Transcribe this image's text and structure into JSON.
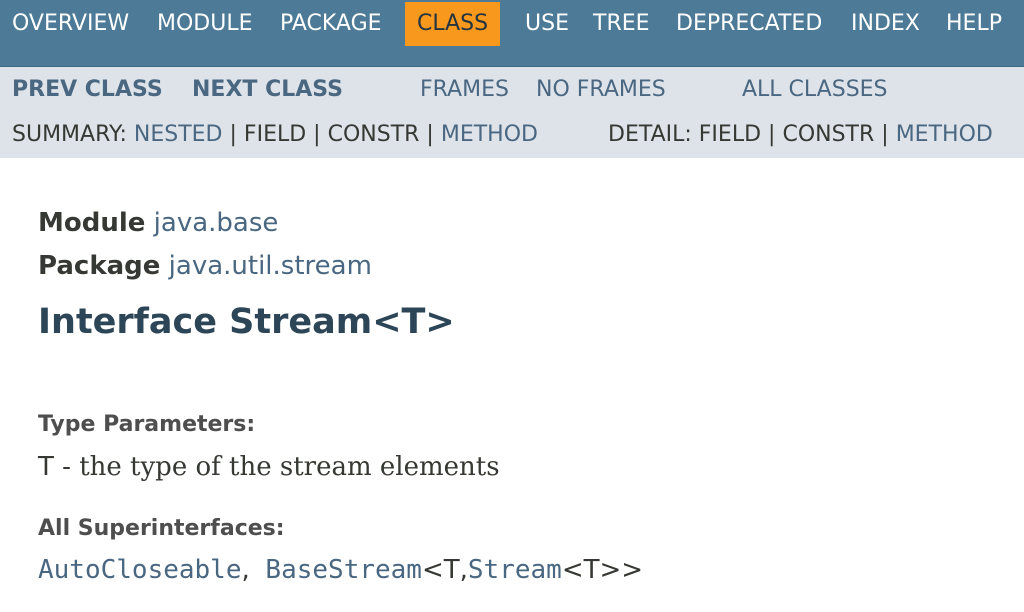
{
  "top_nav": {
    "items": [
      {
        "label": "OVERVIEW",
        "active": false
      },
      {
        "label": "MODULE",
        "active": false
      },
      {
        "label": "PACKAGE",
        "active": false
      },
      {
        "label": "CLASS",
        "active": true
      },
      {
        "label": "USE",
        "active": false
      },
      {
        "label": "TREE",
        "active": false
      },
      {
        "label": "DEPRECATED",
        "active": false
      },
      {
        "label": "INDEX",
        "active": false
      },
      {
        "label": "HELP",
        "active": false
      }
    ],
    "bg_color": "#4D7A97",
    "active_color": "#F8981D"
  },
  "sub_nav": {
    "prev_class": "PREV CLASS",
    "next_class": "NEXT CLASS",
    "frames": "FRAMES",
    "no_frames": "NO FRAMES",
    "all_classes": "ALL CLASSES",
    "summary_label": "SUMMARY:",
    "summary_items": [
      "NESTED",
      "FIELD",
      "CONSTR",
      "METHOD"
    ],
    "detail_label": "DETAIL:",
    "detail_items": [
      "FIELD",
      "CONSTR",
      "METHOD"
    ],
    "separator": "|"
  },
  "header": {
    "module_label": "Module",
    "module_value": "java.base",
    "package_label": "Package",
    "package_value": "java.util.stream",
    "title": "Interface Stream<T>"
  },
  "description": {
    "type_params_label": "Type Parameters:",
    "type_param_name": "T",
    "type_param_desc": " - the type of the stream elements",
    "superinterfaces_label": "All Superinterfaces:",
    "superinterfaces": {
      "first": "AutoCloseable",
      "comma": ",",
      "second": "BaseStream",
      "second_generic_open": "<T,",
      "third": "Stream",
      "third_generic": "<T>>"
    }
  }
}
